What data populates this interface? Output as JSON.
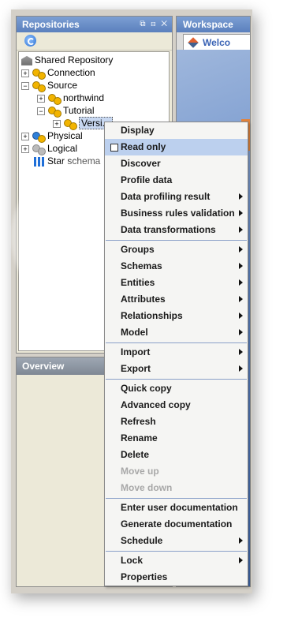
{
  "repositories": {
    "title": "Repositories",
    "controls": "⧉ ⊟ ✕",
    "tree": [
      {
        "label": "Shared Repository"
      },
      {
        "label": "Connection"
      },
      {
        "label": "Source"
      },
      {
        "label": "northwind"
      },
      {
        "label": "Tutorial"
      },
      {
        "label": "Versi..."
      },
      {
        "label": "Physical"
      },
      {
        "label": "Logical"
      },
      {
        "label": "Star schema"
      }
    ]
  },
  "overview": {
    "title": "Overview"
  },
  "workspace": {
    "title": "Workspace",
    "tab_label": "Welco"
  },
  "context_menu": {
    "items": [
      {
        "label": "Display"
      },
      {
        "label": "Read only"
      },
      {
        "label": "Discover"
      },
      {
        "label": "Profile data"
      },
      {
        "label": "Data profiling result"
      },
      {
        "label": "Business rules validation"
      },
      {
        "label": "Data transformations"
      },
      {
        "label": "Groups"
      },
      {
        "label": "Schemas"
      },
      {
        "label": "Entities"
      },
      {
        "label": "Attributes"
      },
      {
        "label": "Relationships"
      },
      {
        "label": "Model"
      },
      {
        "label": "Import"
      },
      {
        "label": "Export"
      },
      {
        "label": "Quick copy"
      },
      {
        "label": "Advanced copy"
      },
      {
        "label": "Refresh"
      },
      {
        "label": "Rename"
      },
      {
        "label": "Delete"
      },
      {
        "label": "Move up"
      },
      {
        "label": "Move down"
      },
      {
        "label": "Enter user documentation"
      },
      {
        "label": "Generate documentation"
      },
      {
        "label": "Schedule"
      },
      {
        "label": "Lock"
      },
      {
        "label": "Properties"
      }
    ]
  }
}
